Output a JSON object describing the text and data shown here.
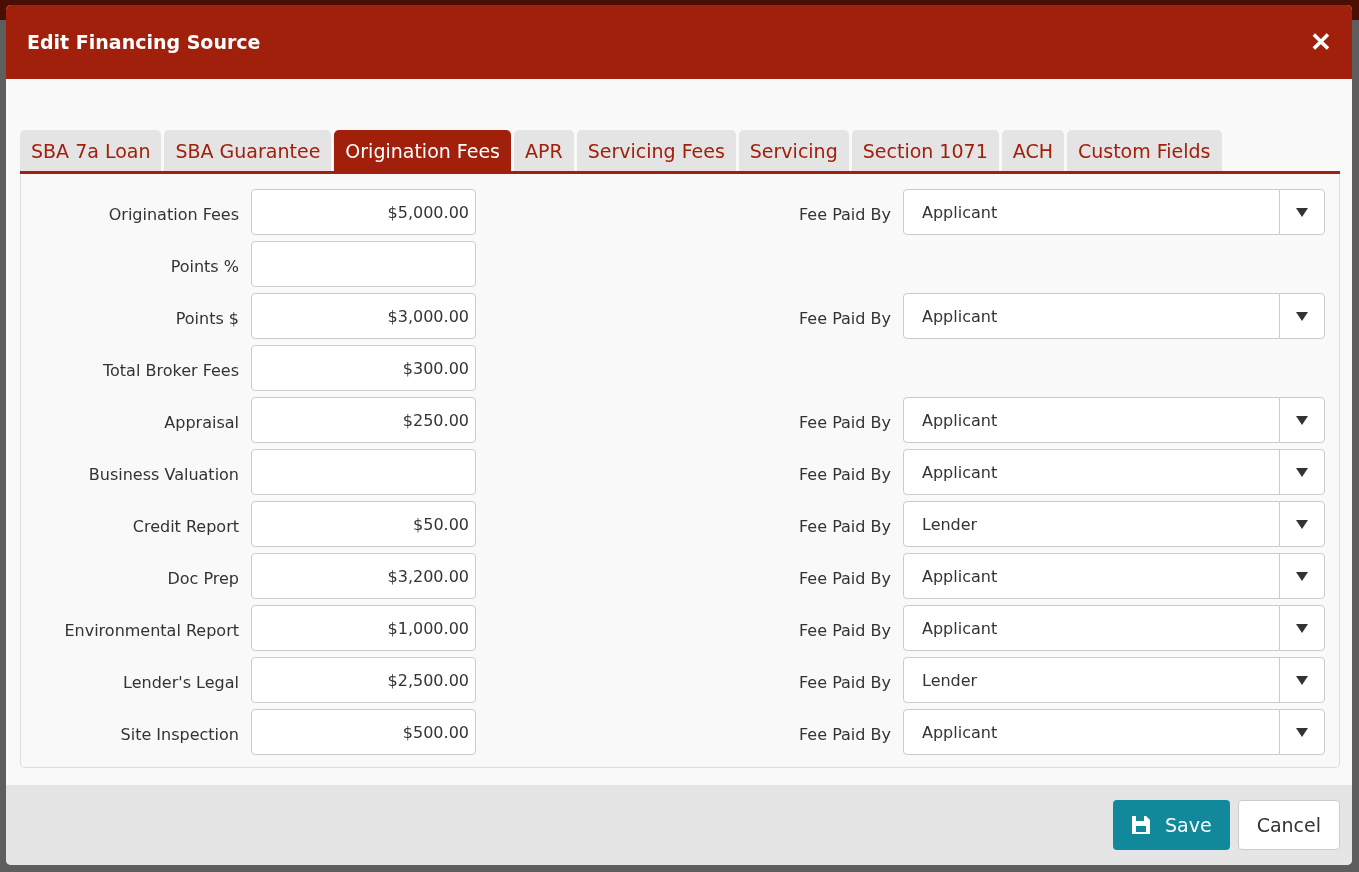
{
  "dialog": {
    "title": "Edit Financing Source",
    "close": "✕"
  },
  "tabs": [
    {
      "label": "SBA 7a Loan",
      "selected": false
    },
    {
      "label": "SBA Guarantee",
      "selected": false
    },
    {
      "label": "Origination Fees",
      "selected": true
    },
    {
      "label": "APR",
      "selected": false
    },
    {
      "label": "Servicing Fees",
      "selected": false
    },
    {
      "label": "Servicing",
      "selected": false
    },
    {
      "label": "Section 1071",
      "selected": false
    },
    {
      "label": "ACH",
      "selected": false
    },
    {
      "label": "Custom Fields",
      "selected": false
    }
  ],
  "fees": [
    {
      "label": "Origination Fees",
      "value": "$5,000.00",
      "paid_by": {
        "label": "Fee Paid By",
        "value": "Applicant"
      }
    },
    {
      "label": "Points %"
    },
    {
      "label": "Points $",
      "value": "$3,000.00",
      "paid_by": {
        "label": "Fee Paid By",
        "value": "Applicant"
      }
    },
    {
      "label": "Total Broker Fees",
      "value": "$300.00"
    },
    {
      "label": "Appraisal",
      "value": "$250.00",
      "paid_by": {
        "label": "Fee Paid By",
        "value": "Applicant"
      }
    },
    {
      "label": "Business Valuation",
      "paid_by": {
        "label": "Fee Paid By",
        "value": "Applicant"
      }
    },
    {
      "label": "Credit Report",
      "value": "$50.00",
      "paid_by": {
        "label": "Fee Paid By",
        "value": "Lender"
      }
    },
    {
      "label": "Doc Prep",
      "value": "$3,200.00",
      "paid_by": {
        "label": "Fee Paid By",
        "value": "Applicant"
      }
    },
    {
      "label": "Environmental Report",
      "value": "$1,000.00",
      "paid_by": {
        "label": "Fee Paid By",
        "value": "Applicant"
      }
    },
    {
      "label": "Lender's Legal",
      "value": "$2,500.00",
      "paid_by": {
        "label": "Fee Paid By",
        "value": "Lender"
      }
    },
    {
      "label": "Site Inspection",
      "value": "$500.00",
      "paid_by": {
        "label": "Fee Paid By",
        "value": "Applicant"
      }
    }
  ],
  "buttons": {
    "save": "Save",
    "cancel": "Cancel"
  }
}
